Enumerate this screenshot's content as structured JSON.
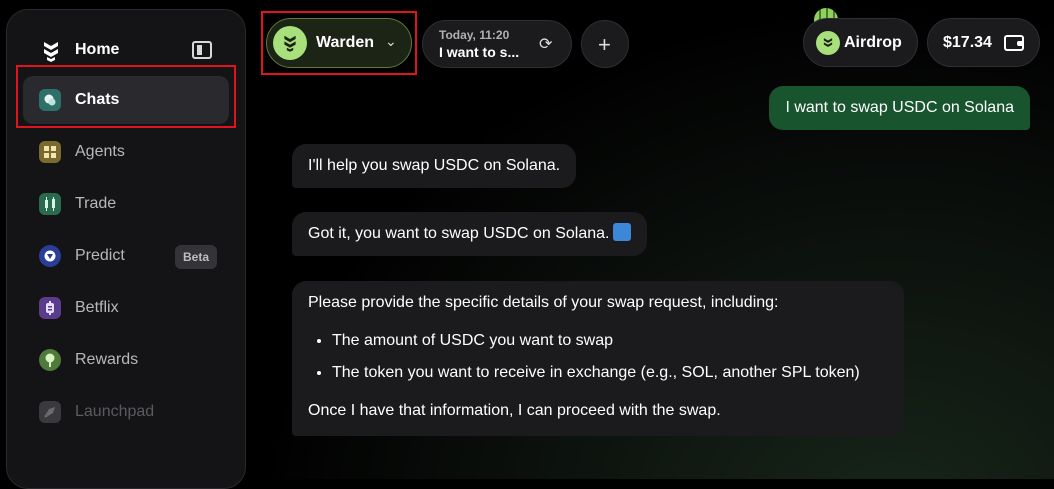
{
  "sidebar": {
    "home_label": "Home",
    "items": [
      {
        "label": "Chats",
        "icon": "chat-icon",
        "color": "#2e6f6a"
      },
      {
        "label": "Agents",
        "icon": "grid-icon",
        "color": "#7a6a2e"
      },
      {
        "label": "Trade",
        "icon": "candles-icon",
        "color": "#2a6a4e"
      },
      {
        "label": "Predict",
        "icon": "shield-icon",
        "color": "#2a3d9a",
        "badge": "Beta"
      },
      {
        "label": "Betflix",
        "icon": "dollar-icon",
        "color": "#5a3d8a"
      },
      {
        "label": "Rewards",
        "icon": "gift-icon",
        "color": "#4e7a3a"
      },
      {
        "label": "Launchpad",
        "icon": "rocket-icon",
        "color": "#3a3a3e"
      }
    ]
  },
  "topbar": {
    "agent_label": "Warden",
    "history_date": "Today, 11:20",
    "history_title": "I want to s...",
    "airdrop_label": "Airdrop",
    "wallet_balance": "$17.34"
  },
  "chat": {
    "user_message": "I want to swap USDC on Solana",
    "bot_message_1": "I'll help you swap USDC on Solana.",
    "bot_message_2": "Got it, you want to swap USDC on Solana.",
    "bot_message_3_intro": "Please provide the specific details of your swap request, including:",
    "bot_message_3_bullets": [
      "The amount of USDC you want to swap",
      "The token you want to receive in exchange (e.g., SOL, another SPL token)"
    ],
    "bot_message_3_outro": "Once I have that information, I can proceed with the swap."
  },
  "colors": {
    "accent_green": "#a8e07c",
    "user_bubble": "#18552f",
    "highlight_red": "#e0141e"
  }
}
